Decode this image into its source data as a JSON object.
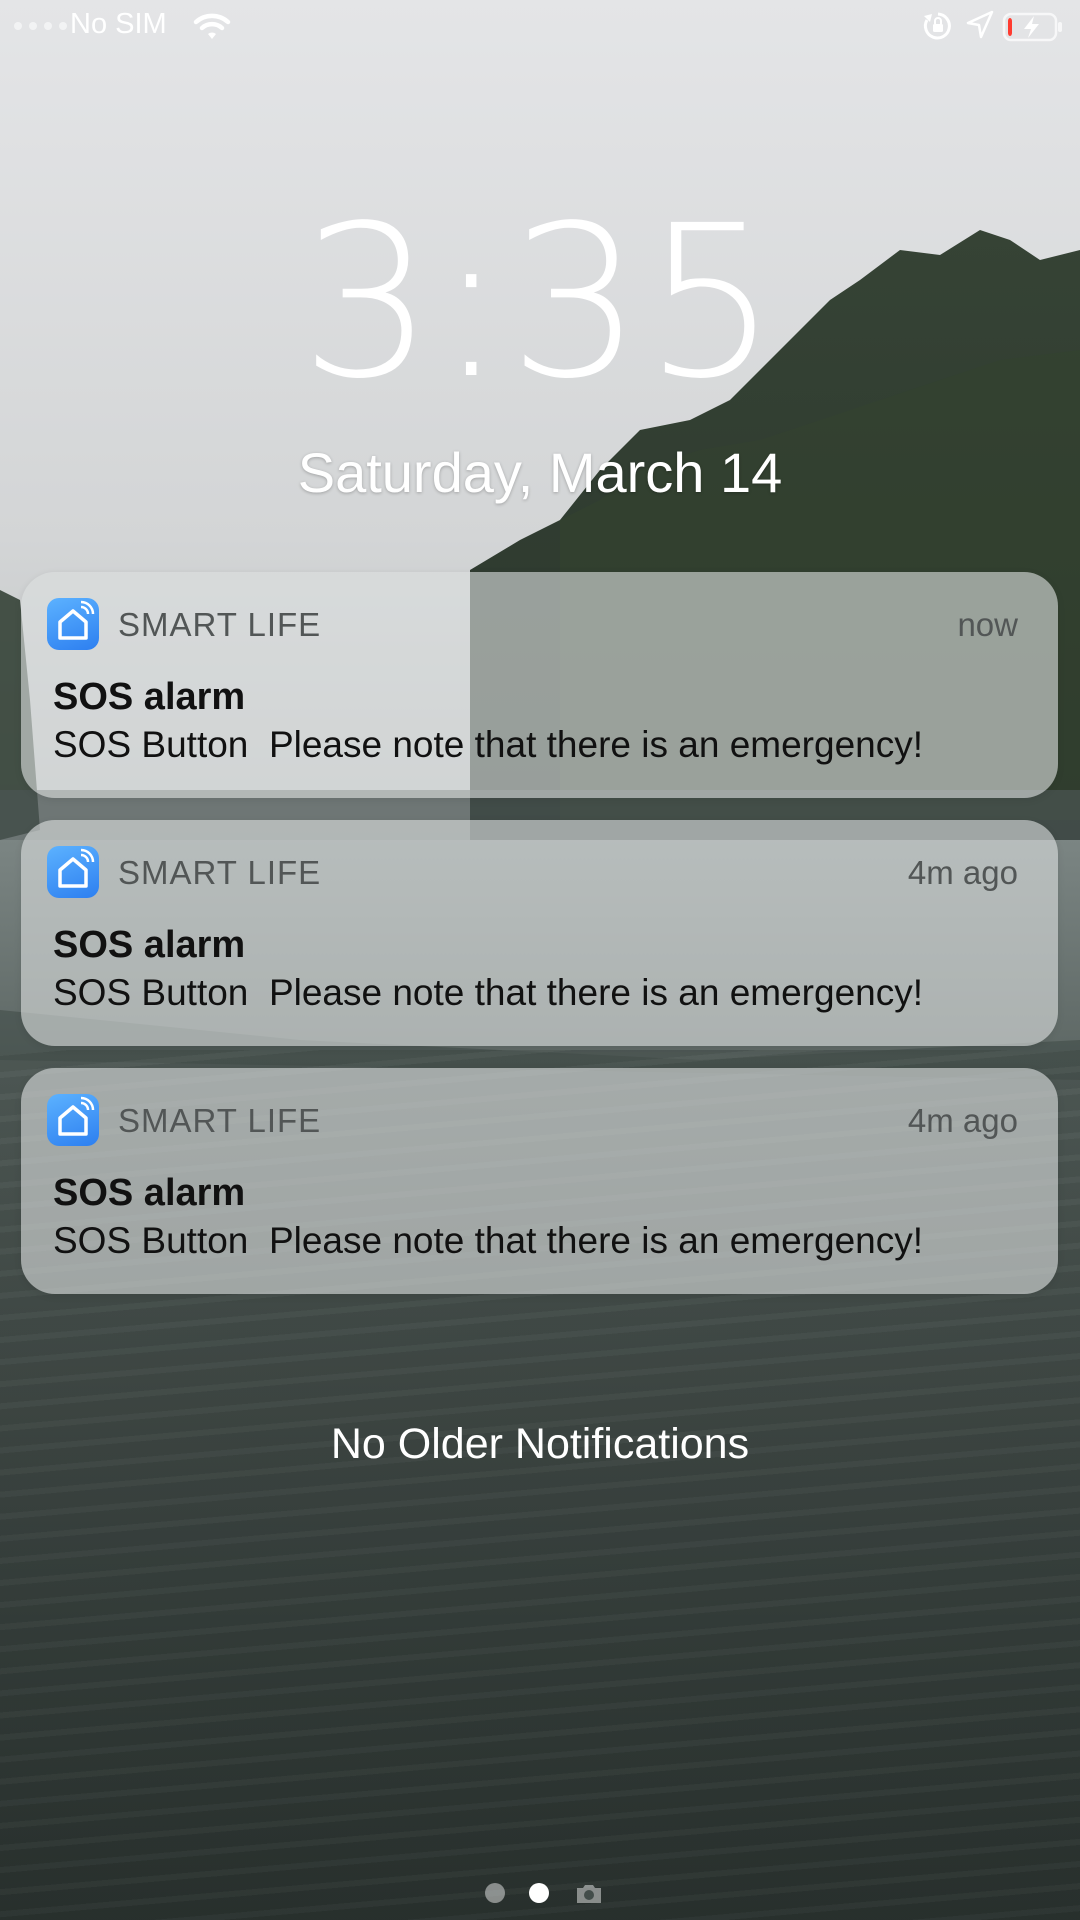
{
  "status_bar": {
    "carrier": "No SIM",
    "icons": [
      "signal-dots-icon",
      "wifi-icon",
      "orientation-lock-icon",
      "location-icon",
      "battery-charging-icon"
    ],
    "battery_level": 0.1,
    "battery_low_color": "#ff3b30"
  },
  "lock_screen": {
    "time": "3:35",
    "date": "Saturday, March 14"
  },
  "notifications": [
    {
      "app": "SMART LIFE",
      "time": "now",
      "title": "SOS alarm",
      "body": "SOS Button  Please note that there is an emergency!",
      "icon": "smart-life-home-icon"
    },
    {
      "app": "SMART LIFE",
      "time": "4m ago",
      "title": "SOS alarm",
      "body": "SOS Button  Please note that there is an emergency!",
      "icon": "smart-life-home-icon"
    },
    {
      "app": "SMART LIFE",
      "time": "4m ago",
      "title": "SOS alarm",
      "body": "SOS Button  Please note that there is an emergency!",
      "icon": "smart-life-home-icon"
    }
  ],
  "footer_text": "No Older Notifications",
  "page_indicator": {
    "pages": 3,
    "current": 2,
    "last_icon": "camera-icon"
  },
  "colors": {
    "app_icon_blue": "#2d7ff0",
    "text_white": "#ffffff"
  }
}
